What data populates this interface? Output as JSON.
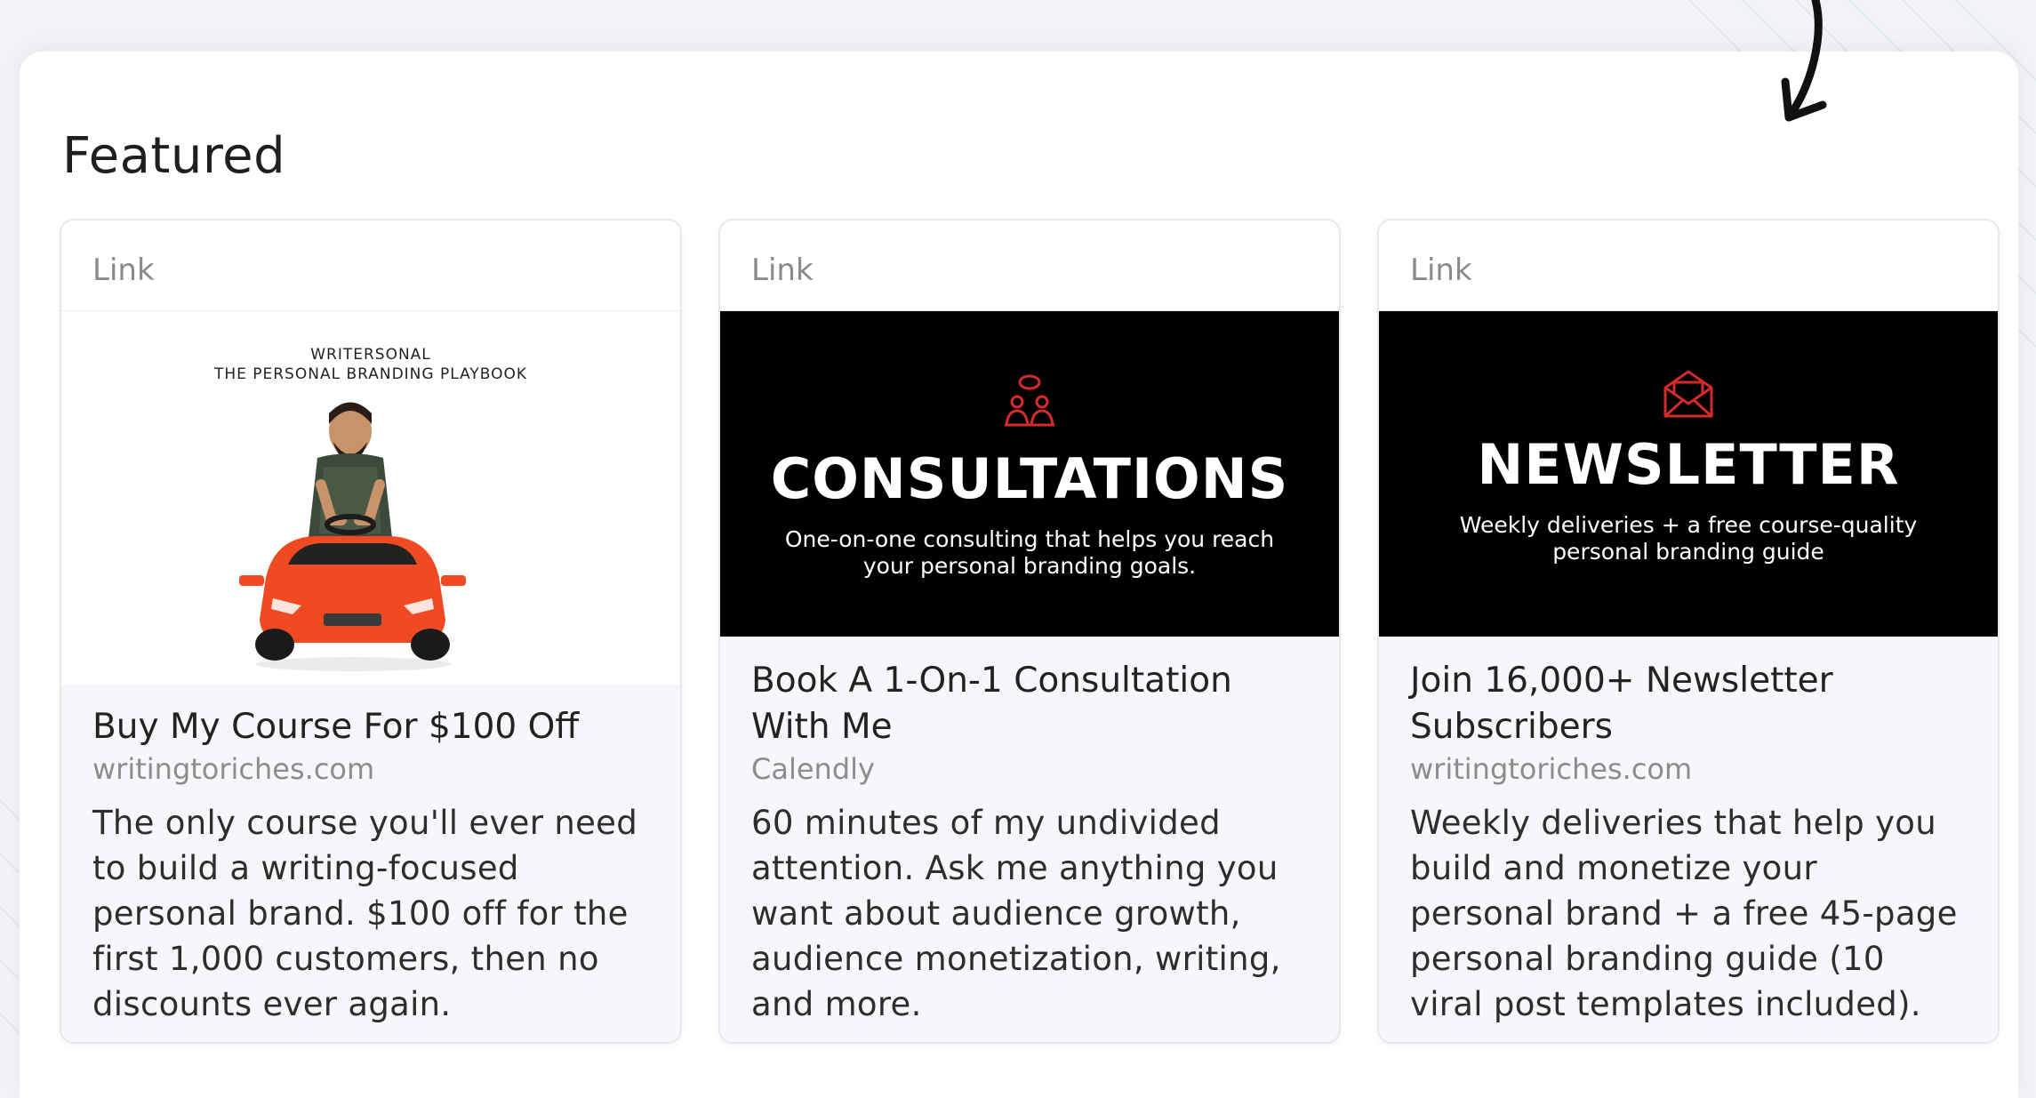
{
  "section": {
    "title": "Featured"
  },
  "cards": [
    {
      "type_label": "Link",
      "image": {
        "kind": "playbook",
        "header_line1": "WRITERSONAL",
        "header_line2": "THE PERSONAL BRANDING PLAYBOOK",
        "illustration": "person-in-red-toy-car"
      },
      "title": "Buy My Course For $100 Off",
      "source": "writingtoriches.com",
      "description": "The only course you'll ever need to build a writing-focused personal brand. $100 off for the first 1,000 customers, then no discounts ever again."
    },
    {
      "type_label": "Link",
      "image": {
        "kind": "banner",
        "icon": "people-chat-icon",
        "heading": "CONSULTATIONS",
        "subtext": "One-on-one consulting that helps you reach your personal branding goals."
      },
      "title": "Book A 1-On-1 Consultation With Me",
      "source": "Calendly",
      "description": "60 minutes of my undivided attention. Ask me anything you want about audience growth, audience monetization, writing, and more."
    },
    {
      "type_label": "Link",
      "image": {
        "kind": "banner",
        "icon": "envelope-icon",
        "heading": "NEWSLETTER",
        "subtext": "Weekly deliveries + a free course-quality personal branding guide"
      },
      "title": "Join 16,000+ Newsletter Subscribers",
      "source": "writingtoriches.com",
      "description": "Weekly deliveries that help you build and monetize your personal brand + a free 45-page personal branding guide (10 viral post templates included)."
    }
  ],
  "colors": {
    "banner_background": "#000000",
    "banner_accent": "#d32b2b",
    "card_background": "#f5f7fa",
    "car_red": "#f04a22"
  }
}
